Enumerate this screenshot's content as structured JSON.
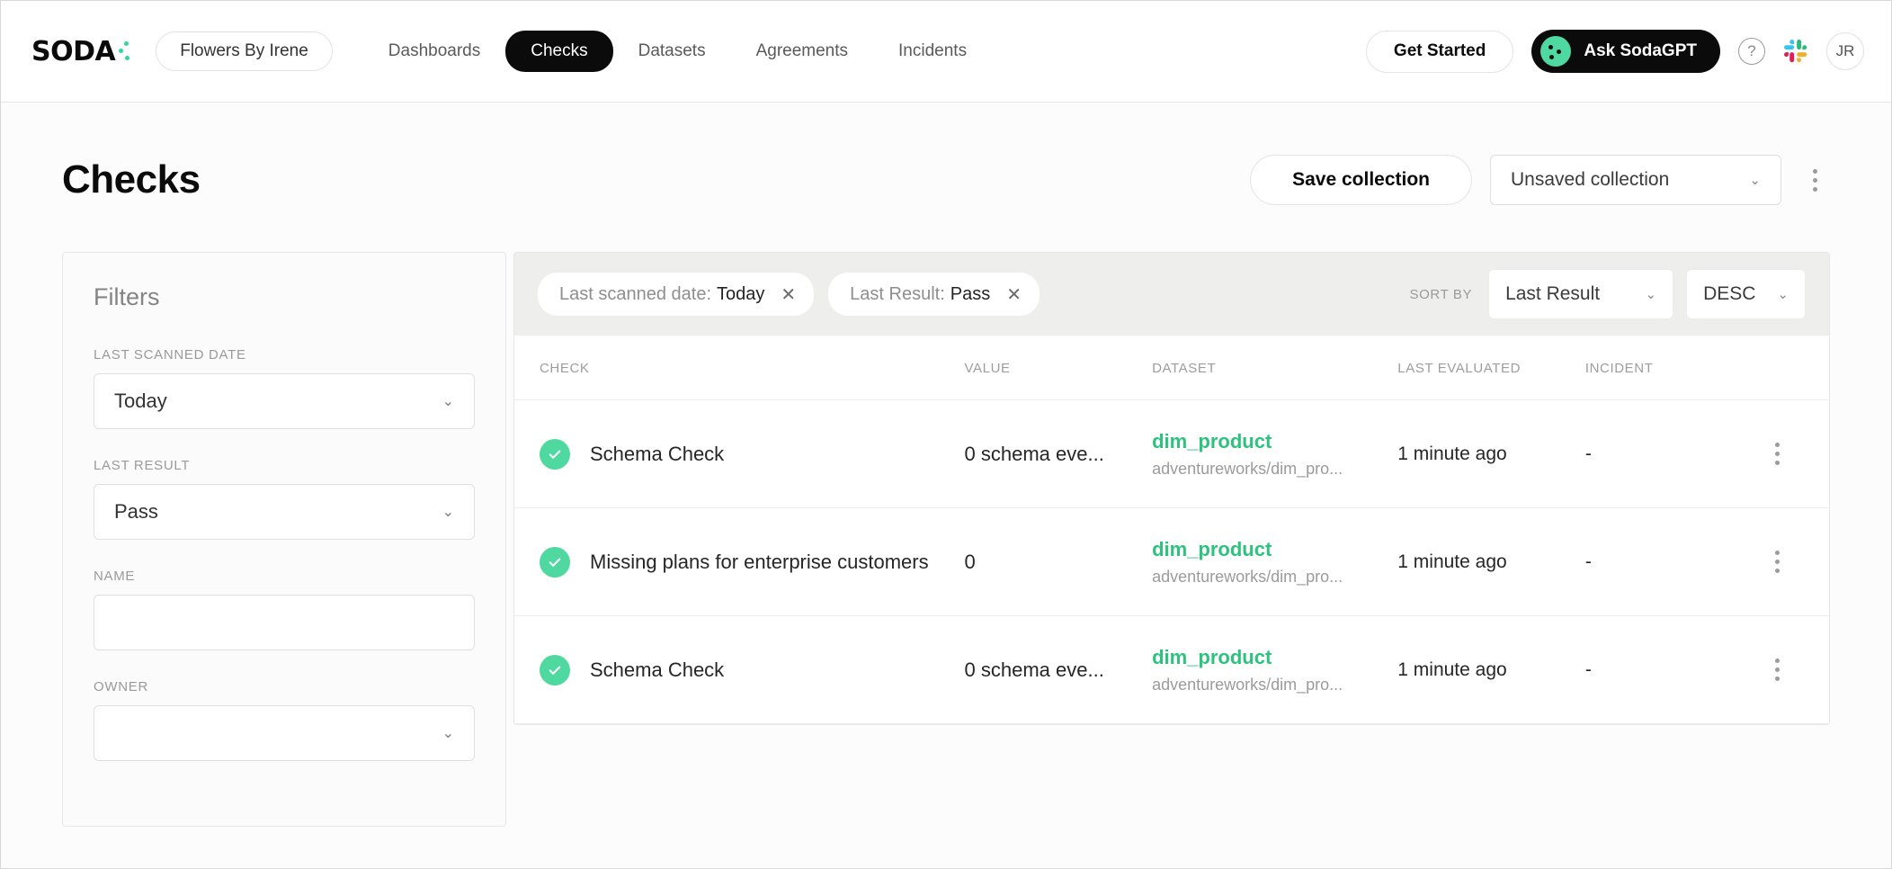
{
  "header": {
    "logo_text": "SODA",
    "workspace": "Flowers By Irene",
    "nav": [
      {
        "label": "Dashboards",
        "active": false
      },
      {
        "label": "Checks",
        "active": true
      },
      {
        "label": "Datasets",
        "active": false
      },
      {
        "label": "Agreements",
        "active": false
      },
      {
        "label": "Incidents",
        "active": false
      }
    ],
    "get_started_label": "Get Started",
    "ask_gpt_label": "Ask SodaGPT",
    "help_glyph": "?",
    "user_initials": "JR",
    "accent_green": "#33d69f",
    "gpt_bg": "#0b0b0b"
  },
  "title_row": {
    "title": "Checks",
    "save_collection_label": "Save collection",
    "collection_select": "Unsaved collection",
    "chevron": "⌄"
  },
  "filters": {
    "heading": "Filters",
    "fields": [
      {
        "label": "LAST SCANNED DATE",
        "value": "Today",
        "type": "select"
      },
      {
        "label": "LAST RESULT",
        "value": "Pass",
        "type": "select"
      },
      {
        "label": "NAME",
        "value": "",
        "type": "input",
        "placeholder": ""
      },
      {
        "label": "OWNER",
        "value": "",
        "type": "select"
      }
    ]
  },
  "toolbar": {
    "chips": [
      {
        "key": "Last scanned date:",
        "value": "Today",
        "close": "✕"
      },
      {
        "key": "Last Result:",
        "value": "Pass",
        "close": "✕"
      }
    ],
    "sort_by_label": "SORT BY",
    "sort_field": "Last Result",
    "sort_direction": "DESC"
  },
  "table": {
    "columns": [
      "CHECK",
      "VALUE",
      "DATASET",
      "LAST EVALUATED",
      "INCIDENT"
    ],
    "rows": [
      {
        "status": "pass",
        "check": "Schema Check",
        "value": "0 schema eve...",
        "dataset_name": "dim_product",
        "dataset_path": "adventureworks/dim_pro...",
        "last_evaluated": "1 minute ago",
        "incident": "-"
      },
      {
        "status": "pass",
        "check": "Missing plans for enterprise customers",
        "value": "0",
        "dataset_name": "dim_product",
        "dataset_path": "adventureworks/dim_pro...",
        "last_evaluated": "1 minute ago",
        "incident": "-"
      },
      {
        "status": "pass",
        "check": "Schema Check",
        "value": "0 schema eve...",
        "dataset_name": "dim_product",
        "dataset_path": "adventureworks/dim_pro...",
        "last_evaluated": "1 minute ago",
        "incident": "-"
      }
    ]
  }
}
